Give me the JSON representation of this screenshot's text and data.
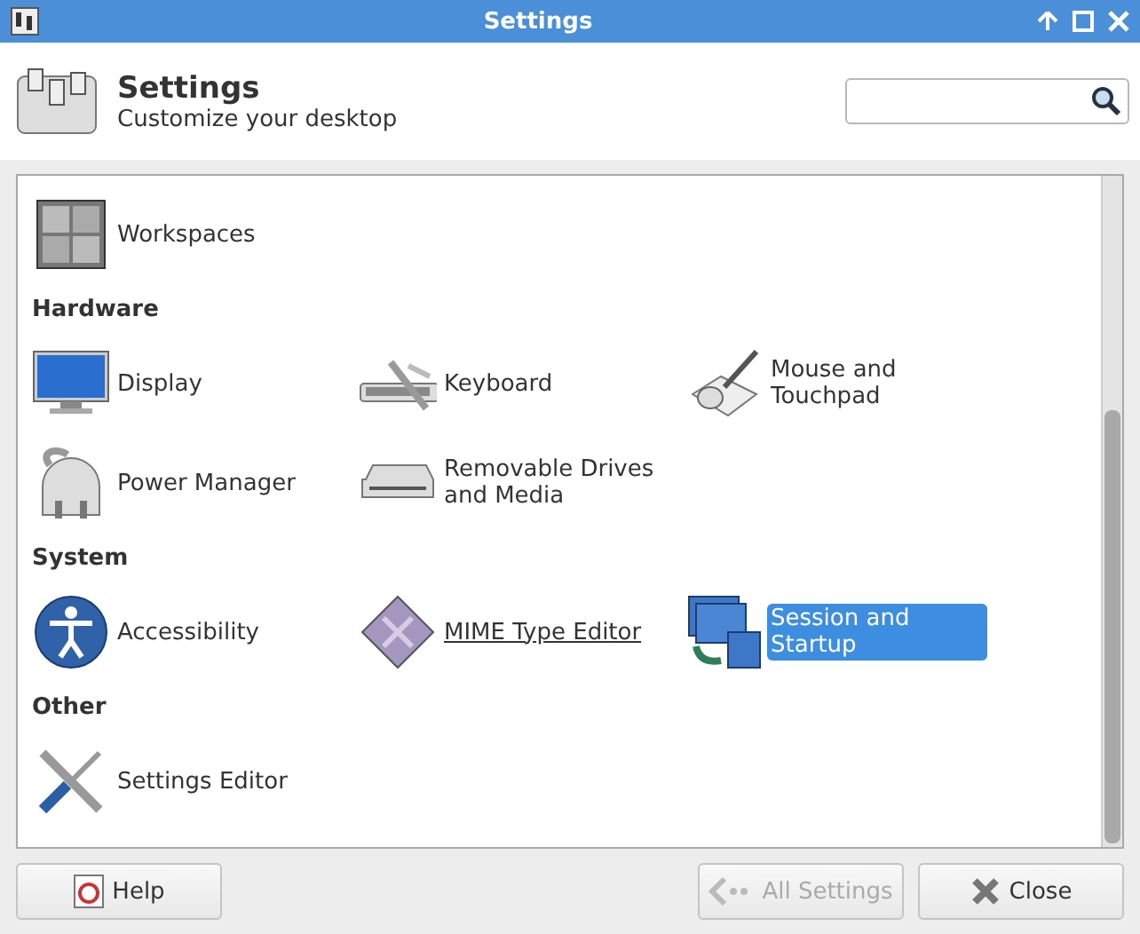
{
  "window": {
    "title": "Settings"
  },
  "header": {
    "title": "Settings",
    "subtitle": "Customize your desktop"
  },
  "sections": [
    {
      "items": [
        {
          "label": "Workspaces",
          "kind": "workspaces",
          "selected": false,
          "hovered": false
        }
      ]
    },
    {
      "heading": "Hardware",
      "items": [
        {
          "label": "Display",
          "kind": "display",
          "selected": false,
          "hovered": false
        },
        {
          "label": "Keyboard",
          "kind": "keyboard",
          "selected": false,
          "hovered": false
        },
        {
          "label": "Mouse and Touchpad",
          "kind": "mouse",
          "selected": false,
          "hovered": false
        },
        {
          "label": "Power Manager",
          "kind": "power",
          "selected": false,
          "hovered": false
        },
        {
          "label": "Removable Drives and Media",
          "kind": "drive",
          "selected": false,
          "hovered": false
        }
      ]
    },
    {
      "heading": "System",
      "items": [
        {
          "label": "Accessibility",
          "kind": "accessibility",
          "selected": false,
          "hovered": false
        },
        {
          "label": "MIME Type Editor",
          "kind": "mime",
          "selected": false,
          "hovered": true
        },
        {
          "label": "Session and Startup",
          "kind": "session",
          "selected": true,
          "hovered": false
        }
      ]
    },
    {
      "heading": "Other",
      "items": [
        {
          "label": "Settings Editor",
          "kind": "tools",
          "selected": false,
          "hovered": false
        }
      ]
    }
  ],
  "buttons": [
    {
      "label": "Help",
      "kind": "help",
      "disabled": false
    },
    {
      "label": "All Settings",
      "kind": "back",
      "disabled": true
    },
    {
      "label": "Close",
      "kind": "close",
      "disabled": false
    }
  ]
}
